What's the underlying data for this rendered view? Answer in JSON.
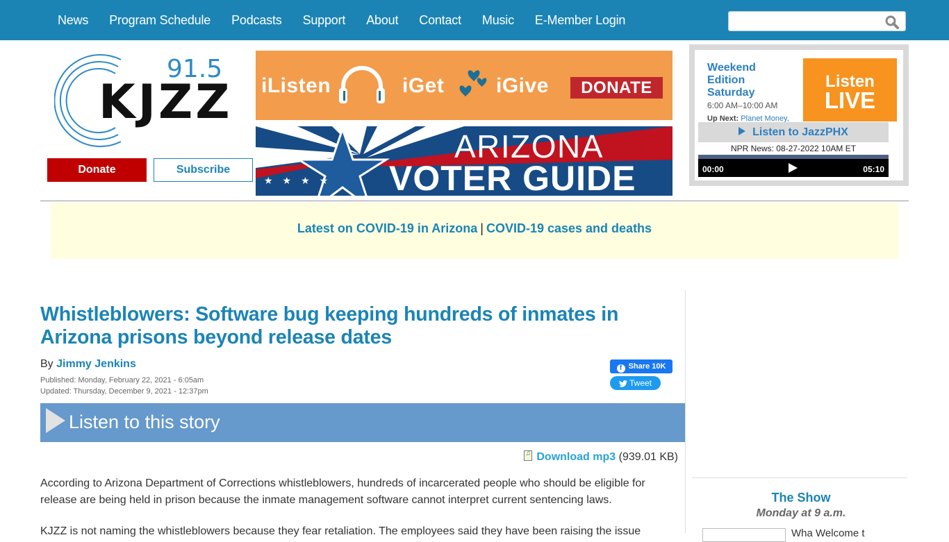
{
  "nav": {
    "items": [
      "News",
      "Program Schedule",
      "Podcasts",
      "Support",
      "About",
      "Contact",
      "Music",
      "E-Member Login"
    ],
    "search_placeholder": "",
    "search_icon": "search-icon"
  },
  "brand": {
    "frequency": "91.5",
    "name": "KJZZ",
    "donate_label": "Donate",
    "subscribe_label": "Subscribe"
  },
  "banners": {
    "support": {
      "words": [
        "iListen",
        "iGet",
        "iGive"
      ],
      "donate_label": "DONATE",
      "bg_color": "#f39c4c"
    },
    "voter_guide": {
      "line1": "ARIZONA",
      "line2": "VOTER GUIDE"
    }
  },
  "live_box": {
    "current_show": "Weekend Edition Saturday",
    "show_time": "6:00 AM–10:00 AM",
    "up_next_label": "Up Next:",
    "up_next_show": "Planet Money,",
    "listen_live_line1": "Listen",
    "listen_live_line2": "LIVE",
    "jazz_label": "Listen to JazzPHX",
    "npr_news": "NPR News: 08-27-2022 10AM ET",
    "player": {
      "current_time": "00:00",
      "duration": "05:10",
      "progress": 0
    }
  },
  "covid_bar": {
    "link1": "Latest on COVID-19 in Arizona",
    "separator": "|",
    "link2": "COVID-19 cases and deaths"
  },
  "article": {
    "headline": "Whistleblowers: Software bug keeping hundreds of inmates in Arizona prisons beyond release dates",
    "by_label": "By",
    "author": "Jimmy Jenkins",
    "published": "Published: Monday, February 22, 2021 - 6:05am",
    "updated": "Updated: Thursday, December 9, 2021 - 12:37pm",
    "share": {
      "facebook_label": "Share 10K",
      "tweet_label": "Tweet"
    },
    "listen_label": "Listen to this story",
    "download_label": "Download mp3",
    "download_size": "(939.01 KB)",
    "paragraphs": [
      "According to Arizona Department of Corrections whistleblowers, hundreds of incarcerated people who should be eligible for release are being held in prison because the inmate management software cannot interpret current sentencing laws.",
      "KJZZ is not naming the whistleblowers because they fear retaliation. The employees said they have been raising the issue"
    ]
  },
  "sidebar": {
    "show_title": "The Show",
    "show_schedule": "Monday at 9 a.m.",
    "show_teaser": "Wha Welcome t"
  },
  "colors": {
    "nav_bg": "#1b84b5",
    "link": "#1b84b5",
    "donate_red": "#c00000",
    "listen_live_orange": "#f7931e",
    "listen_bar": "#6699cc",
    "covid_bg": "#ffffe0"
  }
}
